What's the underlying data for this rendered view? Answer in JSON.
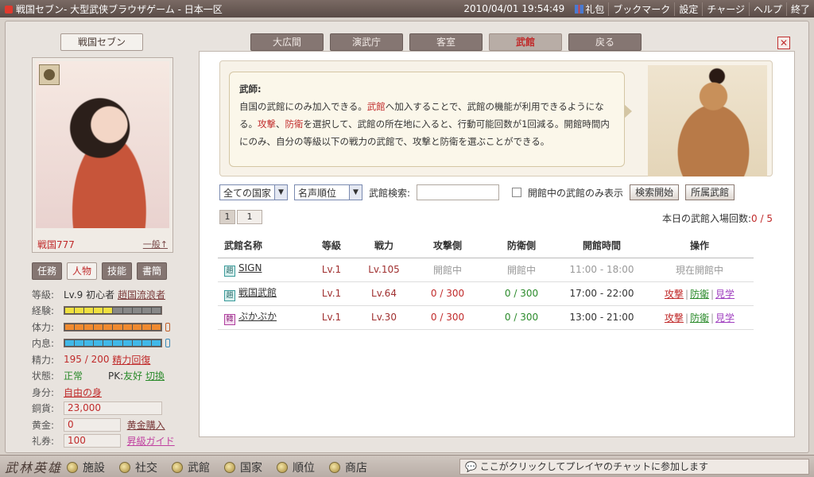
{
  "topbar": {
    "title": "戦国セブン- 大型武侠ブラウザゲーム - 日本一区",
    "datetime": "2010/04/01 19:54:49",
    "menu": [
      "礼包",
      "ブックマーク",
      "設定",
      "チャージ",
      "ヘルプ",
      "終了"
    ]
  },
  "profile": {
    "game_name": "戦国セブン",
    "player_name": "戦国777",
    "rank_link": "一般↑",
    "tabs": [
      "任務",
      "人物",
      "技能",
      "書簡"
    ],
    "active_tab": "人物",
    "level_label": "等級:",
    "level_value": "Lv.9 初心者",
    "level_link": "趙国流浪者",
    "exp_label": "経験:",
    "exp_fill": 0.5,
    "hp_label": "体力:",
    "hp_fill": 1.0,
    "mp_label": "内息:",
    "mp_fill": 1.0,
    "energy_label": "精力:",
    "energy_value": "195 / 200",
    "energy_link": "精力回復",
    "status_label": "状態:",
    "status_value": "正常",
    "pk_label": "PK:",
    "pk_value": "友好",
    "pk_link": "切換",
    "identity_label": "身分:",
    "identity_value": "自由の身",
    "copper_label": "銅貨:",
    "copper_value": "23,000",
    "gold_label": "黄金:",
    "gold_value": "0",
    "gold_link": "黄金購入",
    "voucher_label": "礼券:",
    "voucher_value": "100",
    "voucher_link": "昇級ガイド"
  },
  "main_tabs": [
    "大広間",
    "演武庁",
    "客室",
    "武館",
    "戻る"
  ],
  "active_main_tab": "武館",
  "close_label": "✕",
  "info": {
    "title": "武師:",
    "line1_a": "自国の武館にのみ加入できる。",
    "line1_b": "武館",
    "line1_c": "へ加入することで、武館の機能が利用できるようにな",
    "line2_a": "る。",
    "line2_b": "攻撃",
    "line2_c": "、",
    "line2_d": "防衛",
    "line2_e": "を選択して、武館の所在地に入ると、行動可能回数が1回減る。開館時間内",
    "line3": "にのみ、自分の等級以下の戦力の武館で、攻撃と防衛を選ぶことができる。"
  },
  "filters": {
    "country": "全ての国家",
    "sort": "名声順位",
    "search_label": "武館検索:",
    "search_value": "",
    "open_only_label": "開館中の武館のみ表示",
    "search_button": "検索開始",
    "own_button": "所属武館"
  },
  "pager": {
    "pages": [
      "1",
      "1"
    ]
  },
  "entries": {
    "label": "本日の武館入場回数:",
    "value": "0 / 5"
  },
  "table": {
    "headers": [
      "武館名称",
      "等級",
      "戦力",
      "攻撃側",
      "防衛側",
      "開館時間",
      "操作"
    ],
    "rows": [
      {
        "icon": "趙",
        "name": "SIGN",
        "level": "Lv.1",
        "power": "Lv.105",
        "attack": "開館中",
        "defense": "開館中",
        "hours": "11:00 - 18:00",
        "status": "現在開館中"
      },
      {
        "icon": "趙",
        "name": "戦国武館",
        "level": "Lv.1",
        "power": "Lv.64",
        "attack": "0 / 300",
        "defense": "0 / 300",
        "hours": "17:00 - 22:00",
        "op_attack": "攻撃",
        "op_defense": "防衛",
        "op_watch": "見学"
      },
      {
        "icon": "韓",
        "name": "ぷかぷか",
        "level": "Lv.1",
        "power": "Lv.30",
        "attack": "0 / 300",
        "defense": "0 / 300",
        "hours": "13:00 - 21:00",
        "op_attack": "攻撃",
        "op_defense": "防衛",
        "op_watch": "見学"
      }
    ]
  },
  "bottom": {
    "logo": "武林英雄",
    "nav": [
      "施設",
      "社交",
      "武館",
      "国家",
      "順位",
      "商店"
    ],
    "chat": "ここがクリックしてプレイヤのチャットに参加します"
  }
}
